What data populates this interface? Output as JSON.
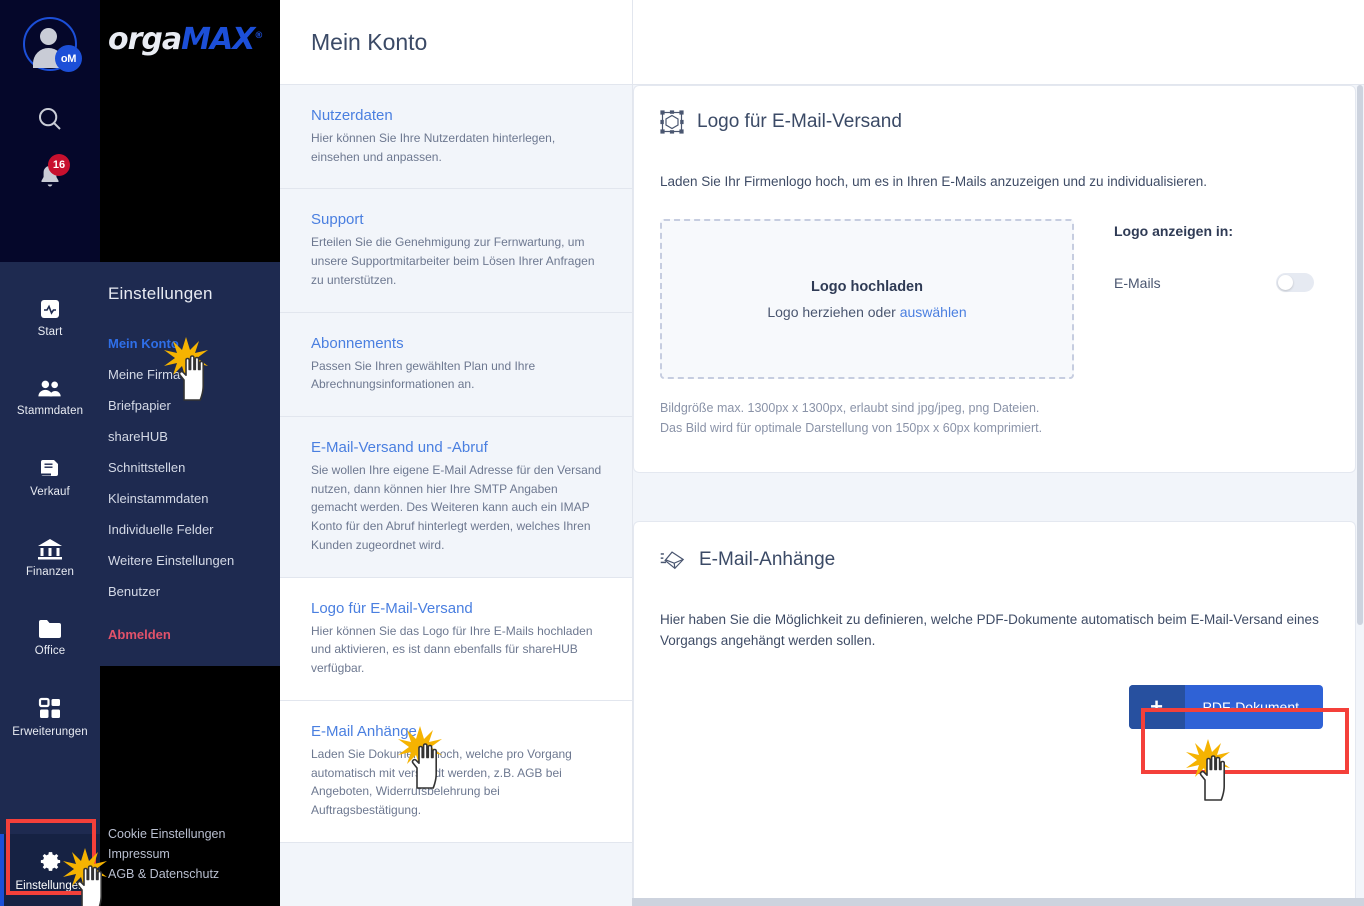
{
  "rail": {
    "avatar_badge": "oM",
    "search_icon": "search-icon",
    "notification_count": "16",
    "items": [
      {
        "label": "Start",
        "icon": "pulse-icon"
      },
      {
        "label": "Stammdaten",
        "icon": "people-icon"
      },
      {
        "label": "Verkauf",
        "icon": "document-icon"
      },
      {
        "label": "Finanzen",
        "icon": "bank-icon"
      },
      {
        "label": "Office",
        "icon": "folder-icon"
      },
      {
        "label": "Erweiterungen",
        "icon": "grid-icon"
      }
    ],
    "bottom": {
      "label": "Einstellungen",
      "icon": "gear-icon"
    }
  },
  "brand": {
    "part1": "orga",
    "part2": "MAX",
    "reg": "®"
  },
  "settings_menu": {
    "title": "Einstellungen",
    "items": [
      "Mein Konto",
      "Meine Firma",
      "Briefpapier",
      "shareHUB",
      "Schnittstellen",
      "Kleinstammdaten",
      "Individuelle Felder",
      "Weitere Einstellungen",
      "Benutzer"
    ],
    "logout": "Abmelden"
  },
  "footer_links": [
    "Cookie Einstellungen",
    "Impressum",
    "AGB & Datenschutz"
  ],
  "page": {
    "title": "Mein Konto"
  },
  "sections": [
    {
      "title": "Nutzerdaten",
      "desc": "Hier können Sie Ihre Nutzerdaten hinterlegen, einsehen und anpassen."
    },
    {
      "title": "Support",
      "desc": "Erteilen Sie die Genehmigung zur Fernwartung, um unsere Supportmitarbeiter beim Lösen Ihrer Anfragen zu unterstützen."
    },
    {
      "title": "Abonnements",
      "desc": "Passen Sie Ihren gewählten Plan und Ihre Abrechnungsinformationen an."
    },
    {
      "title": "E-Mail-Versand und -Abruf",
      "desc": "Sie wollen Ihre eigene E-Mail Adresse für den Versand nutzen, dann können hier Ihre SMTP Angaben gemacht werden. Des Weiteren kann auch ein IMAP Konto für den Abruf hinterlegt werden, welches Ihren Kunden zugeordnet wird."
    },
    {
      "title": "Logo für E-Mail-Versand",
      "desc": "Hier können Sie das Logo für Ihre E-Mails hochladen und aktivieren, es ist dann ebenfalls für shareHUB verfügbar."
    },
    {
      "title": "E-Mail Anhänge",
      "desc": "Laden Sie Dokumente hoch, welche pro Vorgang automatisch mit versandt werden, z.B. AGB bei Angeboten, Widerrufsbelehrung bei Auftragsbestätigung."
    }
  ],
  "logo_card": {
    "icon": "image-shape-icon",
    "title": "Logo für E-Mail-Versand",
    "desc": "Laden Sie Ihr Firmenlogo hoch, um es in Ihren E-Mails anzuzeigen und zu individualisieren.",
    "dropzone_title": "Logo hochladen",
    "dropzone_sub_prefix": "Logo herziehen oder ",
    "dropzone_link": "auswählen",
    "display_title": "Logo anzeigen in:",
    "toggle_label": "E-Mails",
    "toggle_state": "off",
    "hint_line1": "Bildgröße max. 1300px x 1300px, erlaubt sind jpg/jpeg, png Dateien.",
    "hint_line2": "Das Bild wird für optimale Darstellung von 150px x 60px komprimiert."
  },
  "attach_card": {
    "icon": "send-mail-icon",
    "title": "E-Mail-Anhänge",
    "desc": "Hier haben Sie die Möglichkeit zu definieren, welche PDF-Dokumente automatisch beim E-Mail-Versand eines Vorgangs angehängt werden sollen.",
    "button_plus": "+",
    "button_label": "PDF-Dokument"
  },
  "colors": {
    "accent_blue": "#2f62d6",
    "link_blue": "#4a7fe0",
    "rail_bg": "#1e2a50",
    "rail_top_bg": "#05072a",
    "highlight_red": "#f4403a",
    "logout_red": "#e2526a",
    "badge_red": "#c8102e"
  }
}
